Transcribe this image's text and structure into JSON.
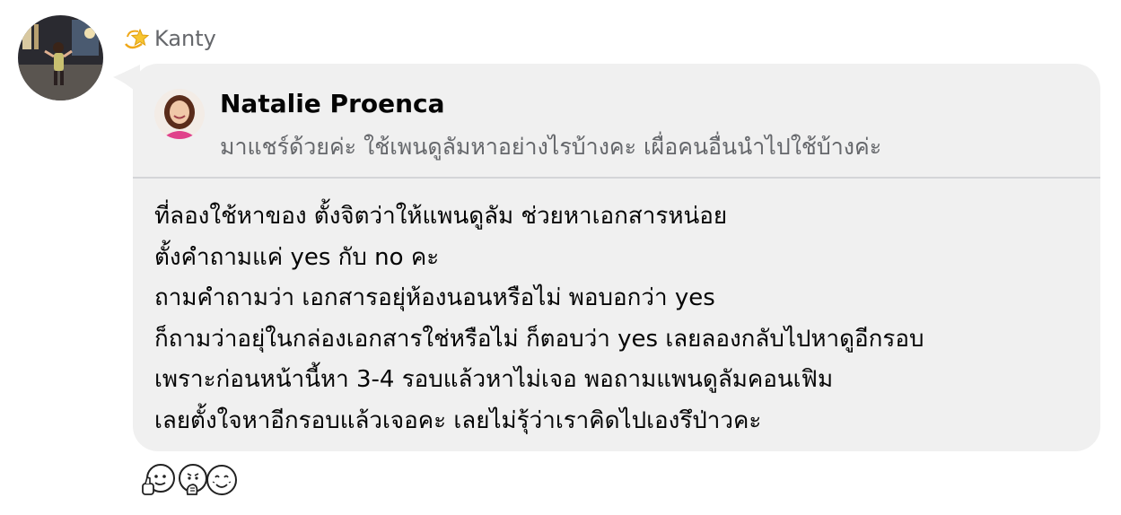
{
  "comment": {
    "author_name": "Kanty",
    "author_icon": "dizzy-star-icon",
    "shared_post": {
      "author_name": "Natalie Proenca",
      "text": "มาแชร์ด้วยค่ะ ใช้เพนดูลัมหาอย่างไรบ้างคะ เผื่อคนอื่นนำไปใช้บ้างค่ะ"
    },
    "lines": [
      "ที่ลองใช้หาของ ตั้งจิตว่าให้แพนดูลัม ช่วยหาเอกสารหน่อย",
      "ตั้งคำถามแค่ yes กับ no คะ",
      "ถามคำถามว่า เอกสารอยุ่ห้องนอนหรือไม่ พอบอกว่า yes",
      "ก็ถามว่าอยุ่ในกล่องเอกสารใช่หรือไม่ ก็ตอบว่า yes เลยลองกลับไปหาดูอีกรอบ",
      "เพราะก่อนหน้านี้หา 3-4 รอบแล้วหาไม่เจอ พอถามแพนดูลัมคอนเฟิม",
      "เลยตั้งใจหาอีกรอบแล้วเจอคะ เลยไม่รุ้ว่าเราคิดไปเองรึป่าวคะ"
    ],
    "reaction_icons": [
      "thumbs-up-face-sticker-icon",
      "thinking-face-sticker-icon",
      "smiling-face-sticker-icon"
    ]
  },
  "colors": {
    "bubble_bg": "#f0f0f0",
    "divider": "#d4d5d8",
    "secondary_text": "#65676b",
    "primary_text": "#050505"
  }
}
